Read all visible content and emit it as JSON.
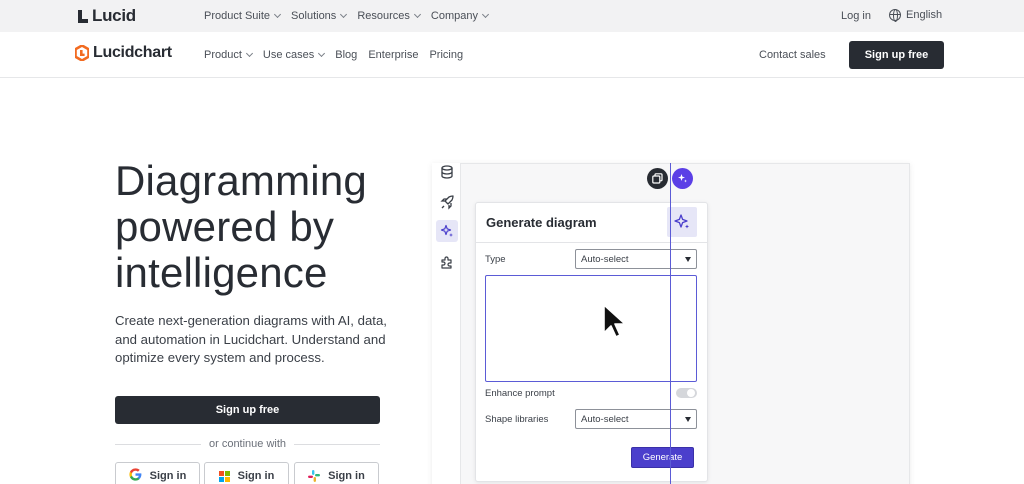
{
  "topbar": {
    "brand": "Lucid",
    "nav": [
      "Product Suite",
      "Solutions",
      "Resources",
      "Company"
    ],
    "login": "Log in",
    "language": "English"
  },
  "mainbar": {
    "brand": "Lucidchart",
    "nav": [
      {
        "label": "Product",
        "dropdown": true
      },
      {
        "label": "Use cases",
        "dropdown": true
      },
      {
        "label": "Blog",
        "dropdown": false
      },
      {
        "label": "Enterprise",
        "dropdown": false
      },
      {
        "label": "Pricing",
        "dropdown": false
      }
    ],
    "contact": "Contact sales",
    "signup": "Sign up free"
  },
  "hero": {
    "title": "Diagramming powered by intelligence",
    "subtitle": "Create next-generation diagrams with AI, data, and automation in Lucidchart. Understand and optimize every system and process.",
    "cta": "Sign up free",
    "divider": "or continue with",
    "sso": [
      {
        "provider": "google",
        "label": "Sign in"
      },
      {
        "provider": "microsoft",
        "label": "Sign in"
      },
      {
        "provider": "slack",
        "label": "Sign in"
      }
    ]
  },
  "demo": {
    "card_title": "Generate diagram",
    "type_label": "Type",
    "type_value": "Auto-select",
    "enhance_label": "Enhance prompt",
    "enhance_on": false,
    "shape_label": "Shape libraries",
    "shape_value": "Auto-select",
    "generate": "Generate",
    "tools": [
      "database-icon",
      "rocket-icon",
      "sparkle-icon",
      "puzzle-icon"
    ],
    "active_tool": "sparkle-icon"
  },
  "colors": {
    "dark": "#282c33",
    "accent": "#4b3fcc",
    "brand_orange": "#f26b21"
  }
}
